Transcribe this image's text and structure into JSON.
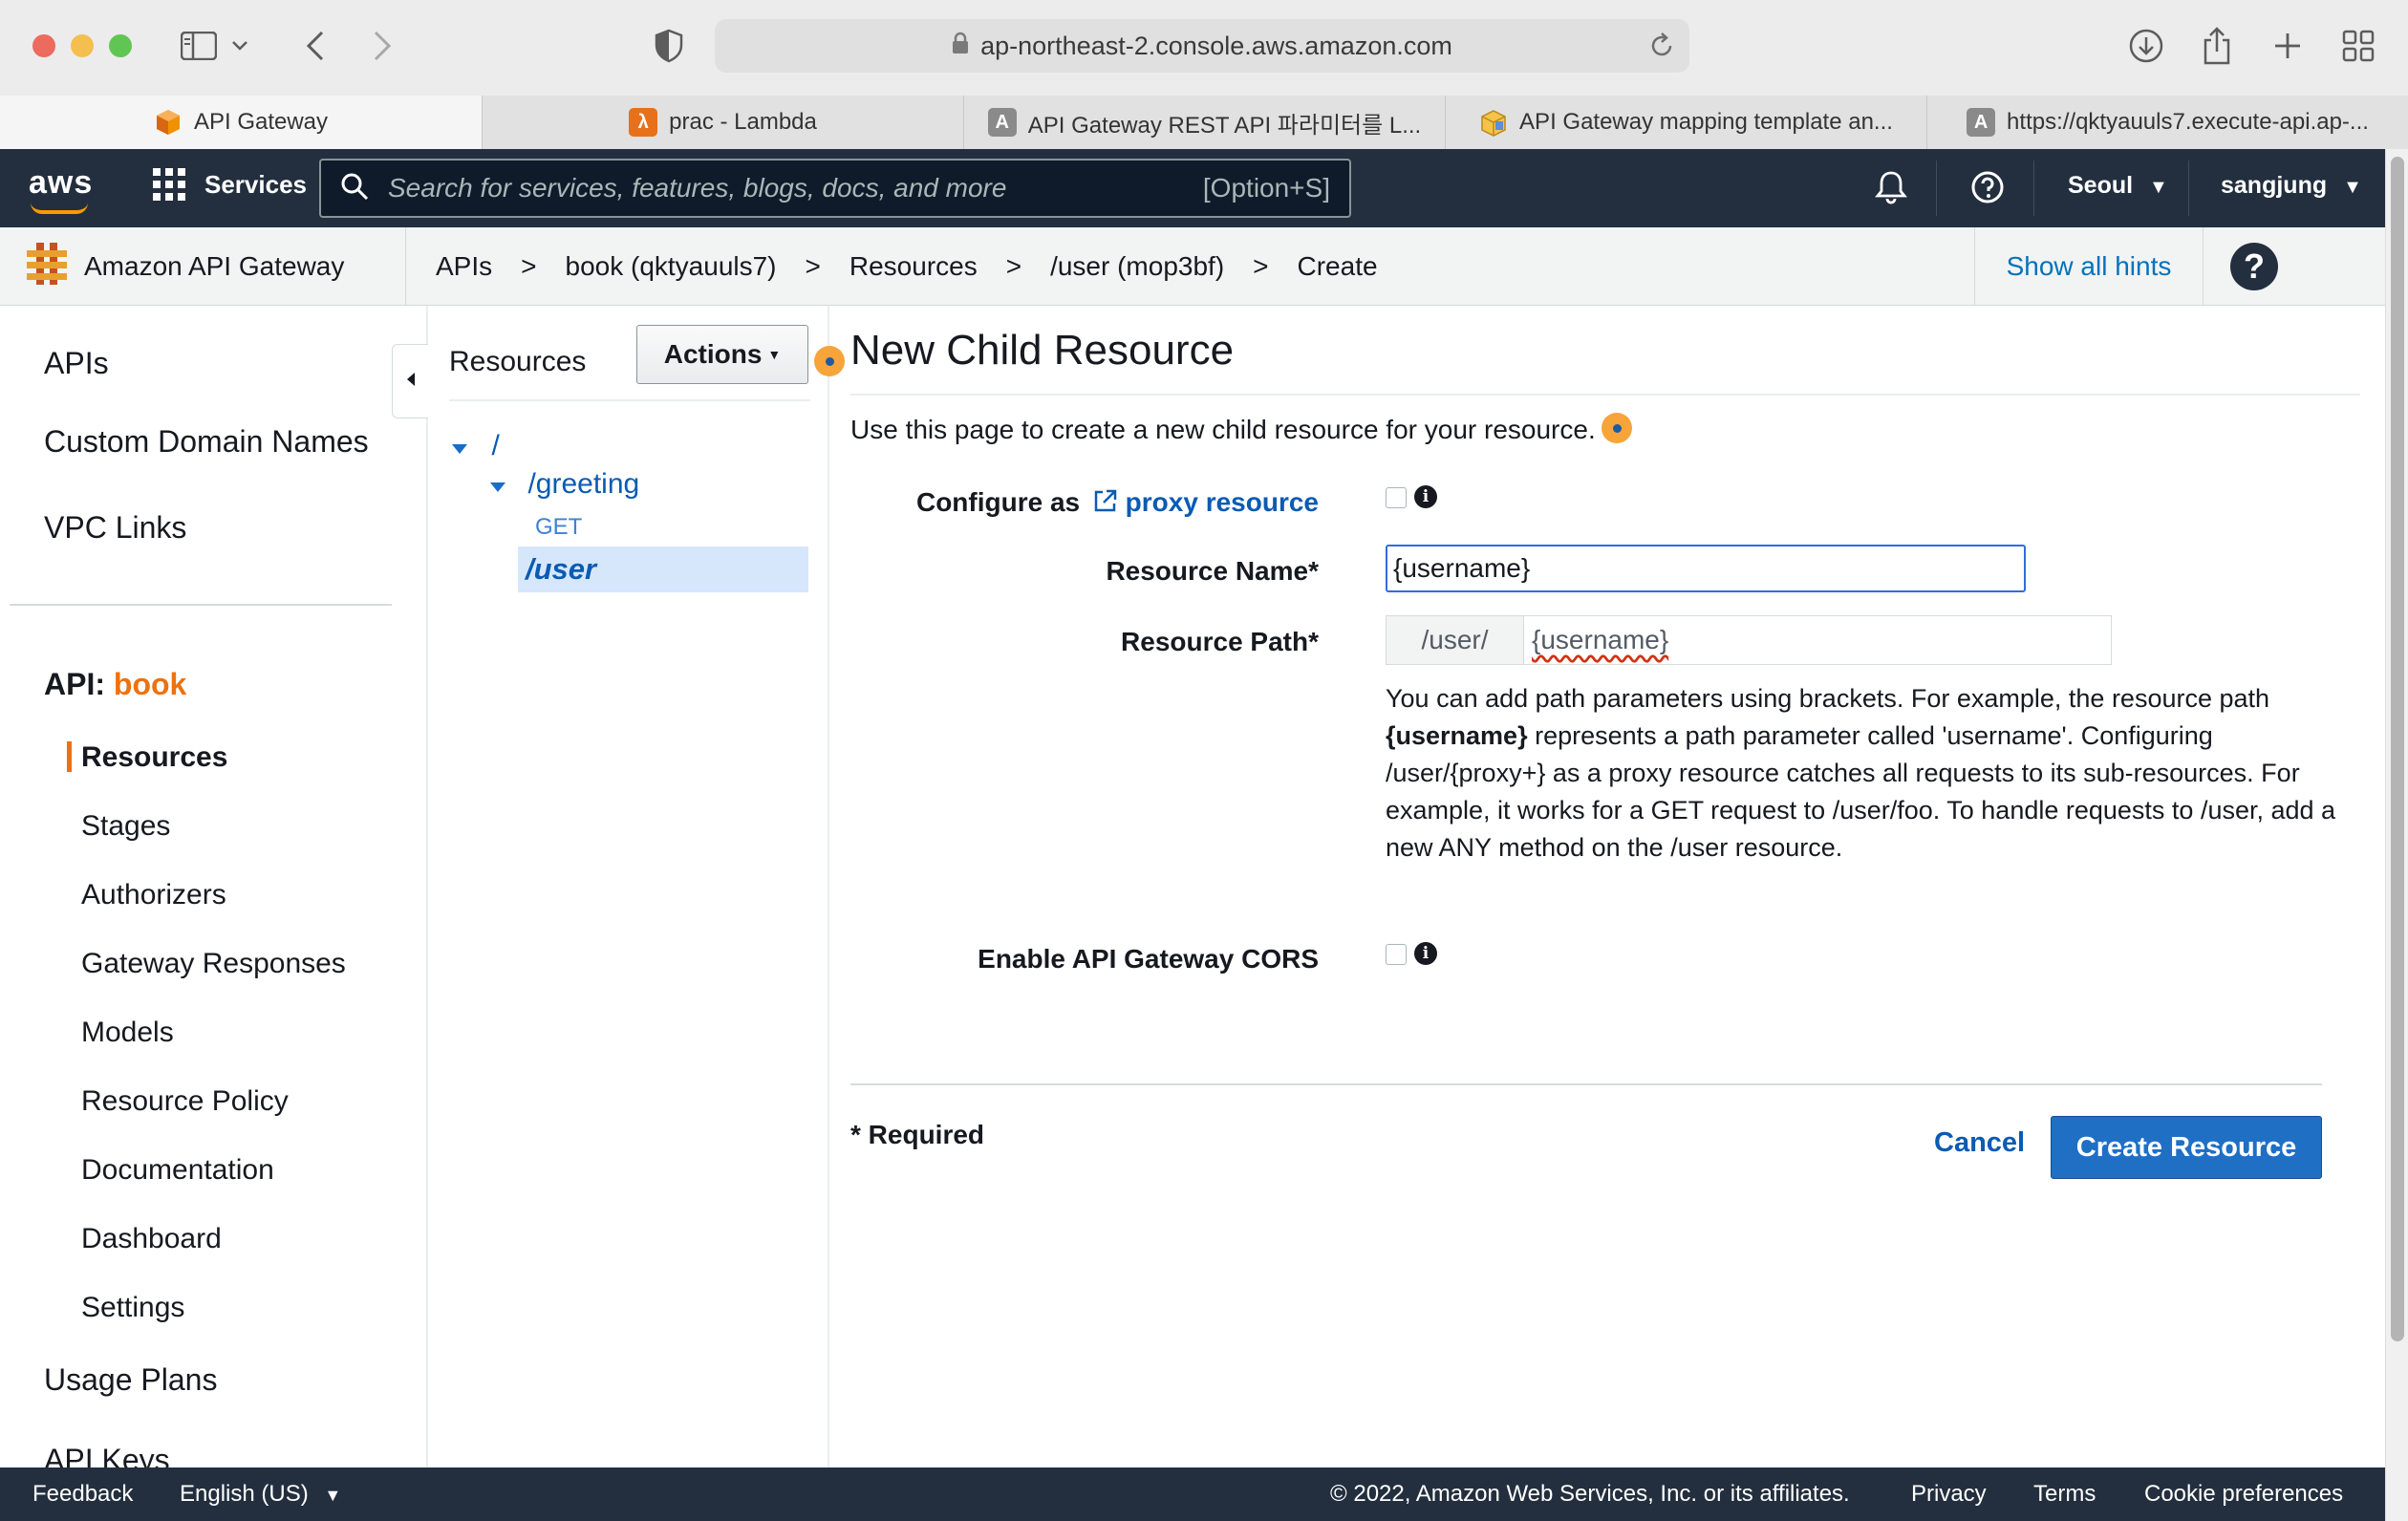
{
  "browser": {
    "url": "ap-northeast-2.console.aws.amazon.com",
    "tabs": [
      {
        "label": "API Gateway",
        "active": true,
        "icon": "aws-cube-icon"
      },
      {
        "label": "prac - Lambda",
        "active": false,
        "icon": "lambda-icon"
      },
      {
        "label": "API Gateway REST API 파라미터를 L...",
        "active": false,
        "icon": "letter-a-icon"
      },
      {
        "label": "API Gateway mapping template an...",
        "active": false,
        "icon": "box-icon"
      },
      {
        "label": "https://qktyauuls7.execute-api.ap-...",
        "active": false,
        "icon": "letter-a-icon"
      }
    ]
  },
  "awsnav": {
    "logo": "aws",
    "services": "Services",
    "search_placeholder": "Search for services, features, blogs, docs, and more",
    "search_shortcut": "[Option+S]",
    "region": "Seoul",
    "user": "sangjung"
  },
  "breadcrumb": {
    "service": "Amazon API Gateway",
    "items": [
      "APIs",
      "book (qktyauuls7)",
      "Resources",
      "/user (mop3bf)",
      "Create"
    ],
    "separator": ">",
    "hints": "Show all hints",
    "help": "?"
  },
  "leftnav": {
    "top_items": [
      "APIs",
      "Custom Domain Names",
      "VPC Links"
    ],
    "api_prefix": "API:",
    "api_name": "book",
    "sub_items": [
      "Resources",
      "Stages",
      "Authorizers",
      "Gateway Responses",
      "Models",
      "Resource Policy",
      "Documentation",
      "Dashboard",
      "Settings"
    ],
    "bottom_items": [
      "Usage Plans",
      "API Keys"
    ]
  },
  "resources": {
    "title": "Resources",
    "actions": "Actions",
    "tree": {
      "root": "/",
      "greeting": "/greeting",
      "greeting_method": "GET",
      "user": "/user"
    }
  },
  "form": {
    "title": "New Child Resource",
    "description": "Use this page to create a new child resource for your resource.",
    "configure_prefix": "Configure as",
    "proxy_link": "proxy resource",
    "resource_name_label": "Resource Name*",
    "resource_name_value": "{username}",
    "resource_path_label": "Resource Path*",
    "resource_path_prefix": "/user/",
    "resource_path_value": "{username}",
    "help_part1": "You can add path parameters using brackets. For example, the resource path ",
    "help_bold": "{username}",
    "help_part2": " represents a path parameter called 'username'. Configuring /user/{proxy+} as a proxy resource catches all requests to its sub-resources. For example, it works for a GET request to /user/foo. To handle requests to /user, add a new ANY method on the /user resource.",
    "cors_label": "Enable API Gateway CORS",
    "required_note": "* Required",
    "cancel": "Cancel",
    "create": "Create Resource"
  },
  "footer": {
    "feedback": "Feedback",
    "language": "English (US)",
    "copyright": "© 2022, Amazon Web Services, Inc. or its affiliates.",
    "privacy": "Privacy",
    "terms": "Terms",
    "cookies": "Cookie preferences"
  },
  "colors": {
    "aws_nav": "#232f3e",
    "accent_orange": "#ec7211",
    "link_blue": "#0073bb",
    "primary_button": "#1f6fc5",
    "selected_row": "#d7e7fb"
  }
}
